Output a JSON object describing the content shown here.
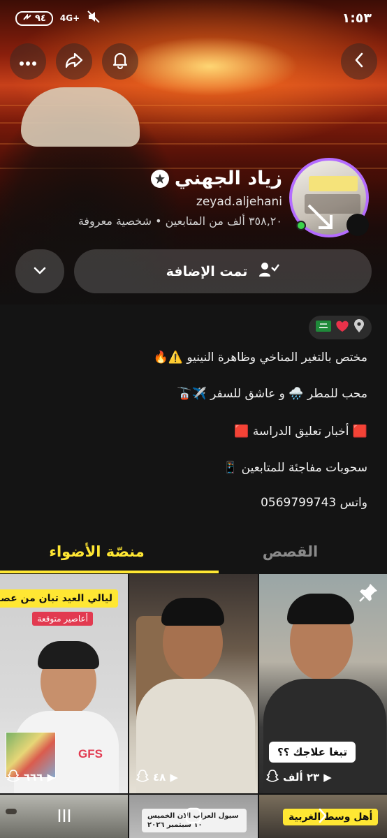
{
  "status_bar": {
    "time": "١:٥٣",
    "battery": "٩٤",
    "network": "4G+"
  },
  "profile": {
    "display_name": "زياد الجهني",
    "username": "zeyad.aljehani",
    "meta": "٣٥٨,٢٠ ألف من المتابعين • شخصية معروفة",
    "action_label": "تمت الإضافة"
  },
  "bio": {
    "pill_icons": [
      "location-icon",
      "heart",
      "saudi-flag"
    ],
    "lines": [
      "مختص بالتغير المناخي وظاهرة النينيو ⚠️🔥",
      "محب للمطر 🌧️ و عاشق للسفر ✈️🚡",
      "🟥 أخبار تعليق الدراسة 🟥",
      "سحوبات مفاجئة للمتابعين 📱",
      "واتس 0569799743"
    ]
  },
  "tabs": {
    "spotlight": "منصّة الأضواء",
    "stories": "القصص"
  },
  "grid": {
    "tiles": [
      {
        "views": "٦٦٦",
        "caption_top": "ليالي العيد تبان من عصاريها",
        "caption_sub": "أعاصير متوقعة",
        "overlay_text": "GFS"
      },
      {
        "views": "٤٨"
      },
      {
        "views": "٢٣ ألف",
        "caption_bottom": "تبغا علاجك ؟؟"
      }
    ],
    "row2": [
      {
        "caption": "أهل وسط الغربية"
      },
      {
        "caption": "سيول العراب الان الخميس ١٠ سبتمبر ٢٠٢٦"
      },
      {
        "caption": ""
      }
    ]
  },
  "colors": {
    "accent_yellow": "#ffe733",
    "story_ring": "#b46cff",
    "background": "#141414"
  }
}
